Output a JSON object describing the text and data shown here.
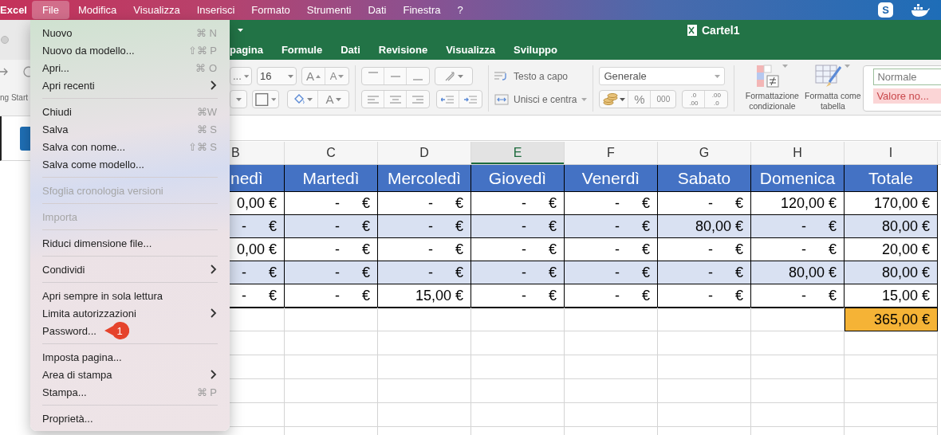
{
  "menu_bar": {
    "app_name": "Excel",
    "items": [
      {
        "label": "File",
        "selected": true
      },
      {
        "label": "Modifica",
        "selected": false
      },
      {
        "label": "Visualizza",
        "selected": false
      },
      {
        "label": "Inserisci",
        "selected": false
      },
      {
        "label": "Formato",
        "selected": false
      },
      {
        "label": "Strumenti",
        "selected": false
      },
      {
        "label": "Dati",
        "selected": false
      },
      {
        "label": "Finestra",
        "selected": false
      },
      {
        "label": "?",
        "selected": false
      }
    ],
    "status_icons": [
      {
        "kind": "letter",
        "text": "S"
      },
      {
        "kind": "whale"
      }
    ]
  },
  "background_window": {
    "label": "ng Start"
  },
  "window": {
    "title": "Cartel1"
  },
  "ribbon_tabs": [
    {
      "label": "pagina",
      "selected": false
    },
    {
      "label": "Formule",
      "selected": false
    },
    {
      "label": "Dati",
      "selected": false
    },
    {
      "label": "Revisione",
      "selected": false
    },
    {
      "label": "Visualizza",
      "selected": false
    },
    {
      "label": "Sviluppo",
      "selected": false
    }
  ],
  "toolbar": {
    "font_name": "...",
    "font_size": "16",
    "grow_font": "A",
    "shrink_font": "A",
    "font_color": "A",
    "wrap_text": "Testo a capo",
    "merge_and_center": "Unisci e centra",
    "number_format": "Generale",
    "percent_style": "%",
    "comma_style": "000",
    "increase_decimal": [
      ".0",
      ".00"
    ],
    "decrease_decimal": [
      ".00",
      ".0"
    ],
    "conditional_formatting": "Formattazione condizionale",
    "format_as_table": "Formatta come tabella",
    "cell_styles": [
      {
        "kind": "normal",
        "label": "Normale"
      },
      {
        "kind": "bad",
        "label": "Valore no..."
      }
    ]
  },
  "file_menu": {
    "items": [
      {
        "kind": "item",
        "label": "Nuovo",
        "shortcut": "⌘ N",
        "submenu": false,
        "disabled": false
      },
      {
        "kind": "item",
        "label": "Nuovo da modello...",
        "shortcut": "⇧⌘ P",
        "submenu": false,
        "disabled": false
      },
      {
        "kind": "item",
        "label": "Apri...",
        "shortcut": "⌘ O",
        "submenu": false,
        "disabled": false
      },
      {
        "kind": "item",
        "label": "Apri recenti",
        "submenu": true,
        "disabled": false
      },
      {
        "kind": "separator"
      },
      {
        "kind": "item",
        "label": "Chiudi",
        "shortcut": "⌘W",
        "submenu": false,
        "disabled": false
      },
      {
        "kind": "item",
        "label": "Salva",
        "shortcut": "⌘ S",
        "submenu": false,
        "disabled": false
      },
      {
        "kind": "item",
        "label": "Salva con nome...",
        "shortcut": "⇧⌘ S",
        "submenu": false,
        "disabled": false
      },
      {
        "kind": "item",
        "label": "Salva come modello...",
        "submenu": false,
        "disabled": false
      },
      {
        "kind": "separator"
      },
      {
        "kind": "item",
        "label": "Sfoglia cronologia versioni",
        "submenu": false,
        "disabled": true
      },
      {
        "kind": "separator"
      },
      {
        "kind": "item",
        "label": "Importa",
        "submenu": false,
        "disabled": true
      },
      {
        "kind": "separator"
      },
      {
        "kind": "item",
        "label": "Riduci dimensione file...",
        "submenu": false,
        "disabled": false
      },
      {
        "kind": "separator"
      },
      {
        "kind": "item",
        "label": "Condividi",
        "submenu": true,
        "disabled": false
      },
      {
        "kind": "separator"
      },
      {
        "kind": "item",
        "label": "Apri sempre in sola lettura",
        "submenu": false,
        "disabled": false
      },
      {
        "kind": "item",
        "label": "Limita autorizzazioni",
        "submenu": true,
        "disabled": false
      },
      {
        "kind": "item",
        "label": "Password...",
        "submenu": false,
        "disabled": false,
        "badge": "1"
      },
      {
        "kind": "separator"
      },
      {
        "kind": "item",
        "label": "Imposta pagina...",
        "submenu": false,
        "disabled": false
      },
      {
        "kind": "item",
        "label": "Area di stampa",
        "submenu": true,
        "disabled": false
      },
      {
        "kind": "item",
        "label": "Stampa...",
        "shortcut": "⌘ P",
        "submenu": false,
        "disabled": false
      },
      {
        "kind": "separator"
      },
      {
        "kind": "item",
        "label": "Proprietà...",
        "submenu": false,
        "disabled": false
      }
    ]
  },
  "sheet": {
    "columns": [
      {
        "label": "B",
        "selected": false
      },
      {
        "label": "C",
        "selected": false
      },
      {
        "label": "D",
        "selected": false
      },
      {
        "label": "E",
        "selected": true
      },
      {
        "label": "F",
        "selected": false
      },
      {
        "label": "G",
        "selected": false
      },
      {
        "label": "H",
        "selected": false
      },
      {
        "label": "I",
        "selected": false
      }
    ],
    "header": [
      "nedì",
      "Martedì",
      "Mercoledì",
      "Giovedì",
      "Venerdì",
      "Sabato",
      "Domenica",
      "Totale"
    ],
    "rows": [
      {
        "shaded": false,
        "cells": [
          {
            "kind": "value",
            "amount": "0,00",
            "currency": "€"
          },
          {
            "kind": "dash",
            "amount": "-",
            "currency": "€"
          },
          {
            "kind": "dash",
            "amount": "-",
            "currency": "€"
          },
          {
            "kind": "dash",
            "amount": "-",
            "currency": "€"
          },
          {
            "kind": "dash",
            "amount": "-",
            "currency": "€"
          },
          {
            "kind": "dash",
            "amount": "-",
            "currency": "€"
          },
          {
            "kind": "value",
            "amount": "120,00",
            "currency": "€"
          },
          {
            "kind": "value",
            "amount": "170,00",
            "currency": "€"
          }
        ]
      },
      {
        "shaded": true,
        "cells": [
          {
            "kind": "dash",
            "amount": "-",
            "currency": "€"
          },
          {
            "kind": "dash",
            "amount": "-",
            "currency": "€"
          },
          {
            "kind": "dash",
            "amount": "-",
            "currency": "€"
          },
          {
            "kind": "dash",
            "amount": "-",
            "currency": "€"
          },
          {
            "kind": "dash",
            "amount": "-",
            "currency": "€"
          },
          {
            "kind": "value",
            "amount": "80,00",
            "currency": "€"
          },
          {
            "kind": "dash",
            "amount": "-",
            "currency": "€"
          },
          {
            "kind": "value",
            "amount": "80,00",
            "currency": "€"
          }
        ]
      },
      {
        "shaded": false,
        "cells": [
          {
            "kind": "value",
            "amount": "0,00",
            "currency": "€"
          },
          {
            "kind": "dash",
            "amount": "-",
            "currency": "€"
          },
          {
            "kind": "dash",
            "amount": "-",
            "currency": "€"
          },
          {
            "kind": "dash",
            "amount": "-",
            "currency": "€"
          },
          {
            "kind": "dash",
            "amount": "-",
            "currency": "€"
          },
          {
            "kind": "dash",
            "amount": "-",
            "currency": "€"
          },
          {
            "kind": "dash",
            "amount": "-",
            "currency": "€"
          },
          {
            "kind": "value",
            "amount": "20,00",
            "currency": "€"
          }
        ]
      },
      {
        "shaded": true,
        "cells": [
          {
            "kind": "dash",
            "amount": "-",
            "currency": "€"
          },
          {
            "kind": "dash",
            "amount": "-",
            "currency": "€"
          },
          {
            "kind": "dash",
            "amount": "-",
            "currency": "€"
          },
          {
            "kind": "dash",
            "amount": "-",
            "currency": "€"
          },
          {
            "kind": "dash",
            "amount": "-",
            "currency": "€"
          },
          {
            "kind": "dash",
            "amount": "-",
            "currency": "€"
          },
          {
            "kind": "value",
            "amount": "80,00",
            "currency": "€"
          },
          {
            "kind": "value",
            "amount": "80,00",
            "currency": "€"
          }
        ]
      },
      {
        "shaded": false,
        "cells": [
          {
            "kind": "dash",
            "amount": "-",
            "currency": "€"
          },
          {
            "kind": "dash",
            "amount": "-",
            "currency": "€"
          },
          {
            "kind": "value",
            "amount": "15,00",
            "currency": "€"
          },
          {
            "kind": "dash",
            "amount": "-",
            "currency": "€"
          },
          {
            "kind": "dash",
            "amount": "-",
            "currency": "€"
          },
          {
            "kind": "dash",
            "amount": "-",
            "currency": "€"
          },
          {
            "kind": "dash",
            "amount": "-",
            "currency": "€"
          },
          {
            "kind": "value",
            "amount": "15,00",
            "currency": "€"
          }
        ]
      }
    ],
    "grand_total": {
      "amount": "365,00",
      "currency": "€"
    }
  }
}
